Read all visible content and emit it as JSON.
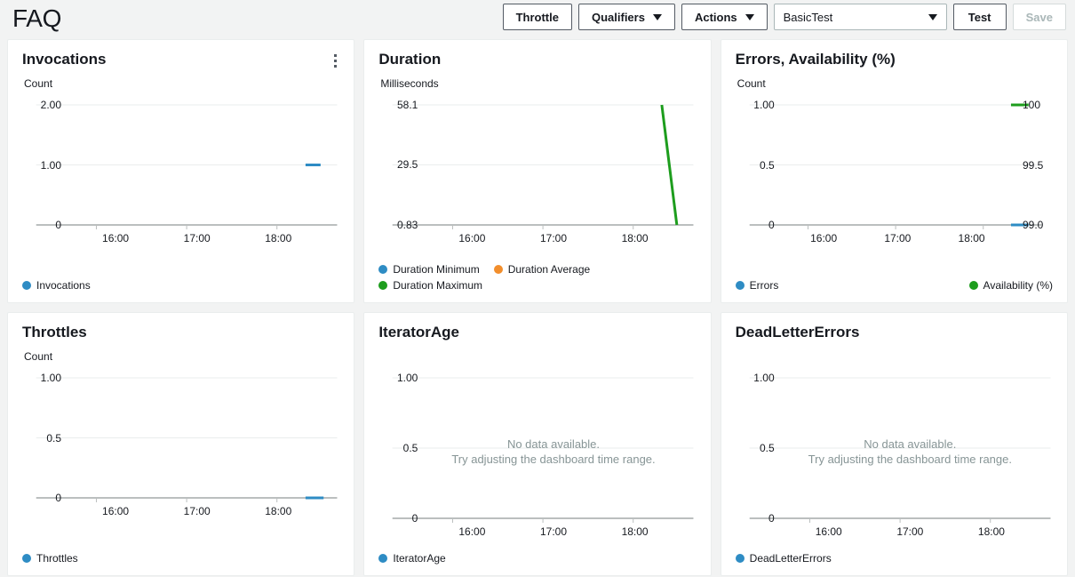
{
  "header": {
    "title": "FAQ",
    "buttons": {
      "throttle": "Throttle",
      "qualifiers": "Qualifiers",
      "actions": "Actions",
      "test": "Test",
      "save": "Save"
    },
    "test_select": {
      "value": "BasicTest"
    }
  },
  "colors": {
    "blue": "#2e8cc4",
    "orange": "#f28e2c",
    "green": "#1d9d1d",
    "gridline": "#eaeded",
    "axis": "#bbbfbf",
    "muted": "#879596"
  },
  "empty_state": {
    "line1": "No data available.",
    "line2": "Try adjusting the dashboard time range."
  },
  "cards": [
    {
      "id": "invocations",
      "title": "Invocations",
      "unit": "Count",
      "has_menu": true,
      "legend": [
        {
          "label": "Invocations",
          "color": "#2e8cc4"
        }
      ]
    },
    {
      "id": "duration",
      "title": "Duration",
      "unit": "Milliseconds",
      "has_menu": false,
      "legend": [
        {
          "label": "Duration Minimum",
          "color": "#2e8cc4"
        },
        {
          "label": "Duration Average",
          "color": "#f28e2c"
        },
        {
          "label": "Duration Maximum",
          "color": "#1d9d1d"
        }
      ]
    },
    {
      "id": "errors-availability",
      "title": "Errors, Availability (%)",
      "unit": "Count",
      "has_menu": false,
      "legend": [
        {
          "label": "Errors",
          "color": "#2e8cc4"
        },
        {
          "label": "Availability (%)",
          "color": "#1d9d1d"
        }
      ]
    },
    {
      "id": "throttles",
      "title": "Throttles",
      "unit": "Count",
      "has_menu": false,
      "legend": [
        {
          "label": "Throttles",
          "color": "#2e8cc4"
        }
      ]
    },
    {
      "id": "iteratorage",
      "title": "IteratorAge",
      "unit": "",
      "has_menu": false,
      "legend": [
        {
          "label": "IteratorAge",
          "color": "#2e8cc4"
        }
      ]
    },
    {
      "id": "deadlettererrors",
      "title": "DeadLetterErrors",
      "unit": "",
      "has_menu": false,
      "legend": [
        {
          "label": "DeadLetterErrors",
          "color": "#2e8cc4"
        }
      ]
    }
  ],
  "chart_data": [
    {
      "id": "invocations",
      "type": "line",
      "title": "Invocations",
      "ylabel": "Count",
      "xlabel": "",
      "yticks": [
        "0",
        "1.00",
        "2.00"
      ],
      "ytick_values": [
        0,
        1,
        2
      ],
      "ylim": [
        0,
        2
      ],
      "xticks": [
        "16:00",
        "17:00",
        "18:00"
      ],
      "xtick_positions": [
        0.2,
        0.5,
        0.8
      ],
      "grid": true,
      "legend_position": "bottom-left",
      "series": [
        {
          "name": "Invocations",
          "color": "#2e8cc4",
          "x": [
            0.895,
            0.945
          ],
          "values": [
            1,
            1
          ]
        }
      ]
    },
    {
      "id": "duration",
      "type": "line",
      "title": "Duration",
      "ylabel": "Milliseconds",
      "xlabel": "",
      "yticks": [
        "0.83",
        "29.5",
        "58.1"
      ],
      "ytick_values": [
        0.83,
        29.5,
        58.1
      ],
      "ylim": [
        0.83,
        58.1
      ],
      "xticks": [
        "16:00",
        "17:00",
        "18:00"
      ],
      "xtick_positions": [
        0.2,
        0.5,
        0.8
      ],
      "grid": true,
      "legend_position": "bottom-left",
      "series": [
        {
          "name": "Duration Minimum",
          "color": "#2e8cc4",
          "x": [],
          "values": []
        },
        {
          "name": "Duration Average",
          "color": "#f28e2c",
          "x": [],
          "values": []
        },
        {
          "name": "Duration Maximum",
          "color": "#1d9d1d",
          "x": [
            0.895,
            0.945
          ],
          "values": [
            58.1,
            0.83
          ]
        }
      ]
    },
    {
      "id": "errors-availability",
      "type": "line",
      "title": "Errors, Availability (%)",
      "ylabel": "Count",
      "xlabel": "",
      "yticks": [
        "0",
        "0.5",
        "1.00"
      ],
      "ytick_values": [
        0,
        0.5,
        1
      ],
      "ylim": [
        0,
        1
      ],
      "y2ticks": [
        "99.0",
        "99.5",
        "100"
      ],
      "y2tick_values": [
        99.0,
        99.5,
        100
      ],
      "y2lim": [
        99.0,
        100
      ],
      "xticks": [
        "16:00",
        "17:00",
        "18:00"
      ],
      "xtick_positions": [
        0.2,
        0.5,
        0.8
      ],
      "grid": true,
      "legend_position": "bottom-spread",
      "series": [
        {
          "name": "Errors",
          "color": "#2e8cc4",
          "axis": "left",
          "x": [
            0.895,
            0.955
          ],
          "values": [
            0,
            0
          ]
        },
        {
          "name": "Availability (%)",
          "color": "#1d9d1d",
          "axis": "right",
          "x": [
            0.895,
            0.955
          ],
          "values": [
            100,
            100
          ]
        }
      ]
    },
    {
      "id": "throttles",
      "type": "line",
      "title": "Throttles",
      "ylabel": "Count",
      "xlabel": "",
      "yticks": [
        "0",
        "0.5",
        "1.00"
      ],
      "ytick_values": [
        0,
        0.5,
        1
      ],
      "ylim": [
        0,
        1
      ],
      "xticks": [
        "16:00",
        "17:00",
        "18:00"
      ],
      "xtick_positions": [
        0.2,
        0.5,
        0.8
      ],
      "grid": true,
      "legend_position": "bottom-left",
      "series": [
        {
          "name": "Throttles",
          "color": "#2e8cc4",
          "x": [
            0.895,
            0.955
          ],
          "values": [
            0,
            0
          ]
        }
      ]
    },
    {
      "id": "iteratorage",
      "type": "line",
      "title": "IteratorAge",
      "ylabel": "",
      "xlabel": "",
      "yticks": [
        "0",
        "0.5",
        "1.00"
      ],
      "ytick_values": [
        0,
        0.5,
        1
      ],
      "ylim": [
        0,
        1
      ],
      "xticks": [
        "16:00",
        "17:00",
        "18:00"
      ],
      "xtick_positions": [
        0.2,
        0.5,
        0.8
      ],
      "grid": true,
      "legend_position": "bottom-left",
      "empty": true,
      "series": [
        {
          "name": "IteratorAge",
          "color": "#2e8cc4",
          "x": [],
          "values": []
        }
      ]
    },
    {
      "id": "deadlettererrors",
      "type": "line",
      "title": "DeadLetterErrors",
      "ylabel": "",
      "xlabel": "",
      "yticks": [
        "0",
        "0.5",
        "1.00"
      ],
      "ytick_values": [
        0,
        0.5,
        1
      ],
      "ylim": [
        0,
        1
      ],
      "xticks": [
        "16:00",
        "17:00",
        "18:00"
      ],
      "xtick_positions": [
        0.2,
        0.5,
        0.8
      ],
      "grid": true,
      "legend_position": "bottom-left",
      "empty": true,
      "series": [
        {
          "name": "DeadLetterErrors",
          "color": "#2e8cc4",
          "x": [],
          "values": []
        }
      ]
    }
  ]
}
